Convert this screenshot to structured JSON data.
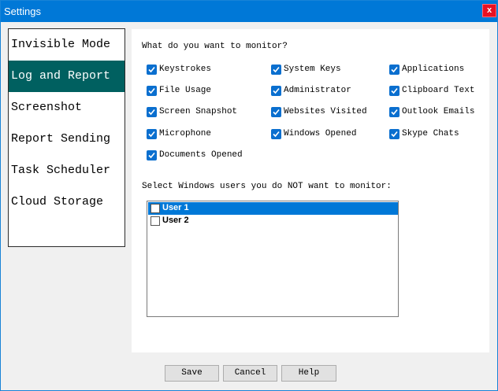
{
  "window": {
    "title": "Settings",
    "close_label": "x"
  },
  "sidebar": {
    "items": [
      {
        "label": "Invisible Mode",
        "active": false
      },
      {
        "label": "Log and Report",
        "active": true
      },
      {
        "label": "Screenshot",
        "active": false
      },
      {
        "label": "Report Sending",
        "active": false
      },
      {
        "label": "Task Scheduler",
        "active": false
      },
      {
        "label": "Cloud Storage",
        "active": false
      }
    ]
  },
  "monitor": {
    "question": "What do you want to monitor?",
    "options": [
      {
        "label": "Keystrokes",
        "checked": true
      },
      {
        "label": "System Keys",
        "checked": true
      },
      {
        "label": "Applications",
        "checked": true
      },
      {
        "label": "File Usage",
        "checked": true
      },
      {
        "label": "Administrator",
        "checked": true
      },
      {
        "label": "Clipboard Text",
        "checked": true
      },
      {
        "label": "Screen Snapshot",
        "checked": true
      },
      {
        "label": "Websites Visited",
        "checked": true
      },
      {
        "label": "Outlook Emails",
        "checked": true
      },
      {
        "label": "Microphone",
        "checked": true
      },
      {
        "label": "Windows Opened",
        "checked": true
      },
      {
        "label": "Skype Chats",
        "checked": true
      },
      {
        "label": "Documents Opened",
        "checked": true
      }
    ]
  },
  "users": {
    "prompt": "Select Windows users you do NOT want to monitor:",
    "list": [
      {
        "name": "User 1",
        "checked": false,
        "selected": true
      },
      {
        "name": "User 2",
        "checked": false,
        "selected": false
      }
    ]
  },
  "buttons": {
    "save": "Save",
    "cancel": "Cancel",
    "help": "Help"
  },
  "colors": {
    "title_bar": "#0078d7",
    "active_nav": "#006060",
    "checkbox": "#0a6fcf",
    "close": "#e81123"
  }
}
